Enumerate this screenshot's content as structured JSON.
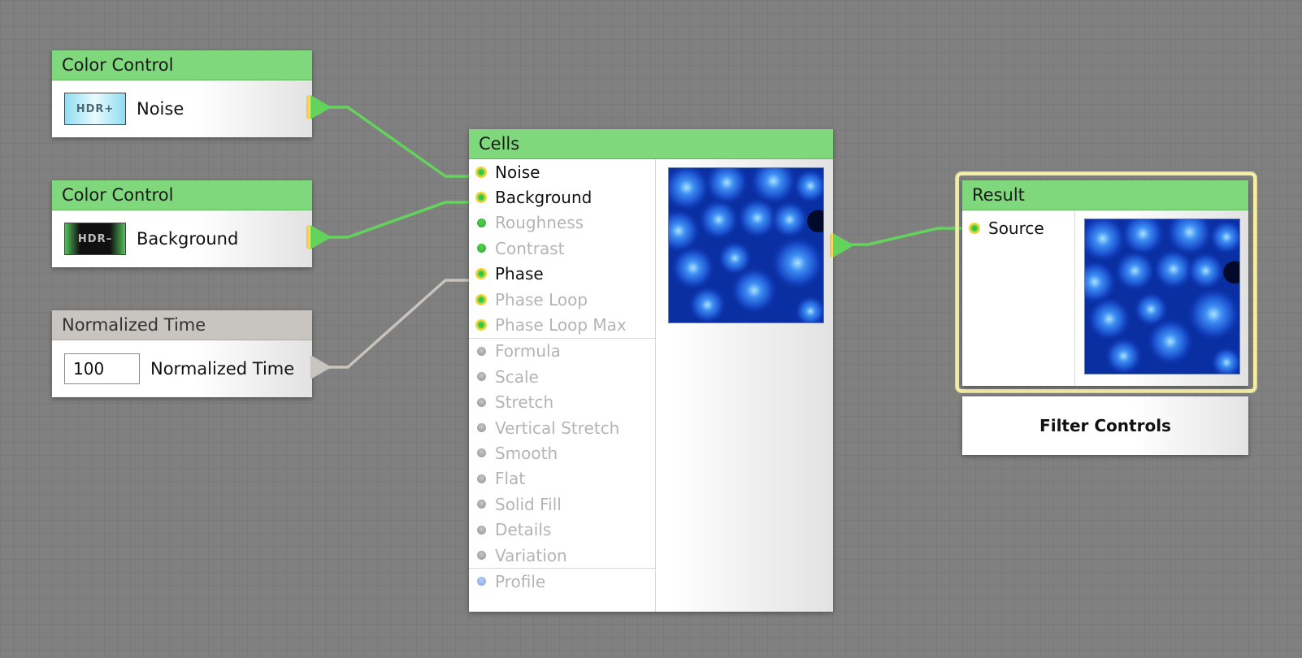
{
  "nodes": {
    "color_control_1": {
      "title": "Color Control",
      "badge": "HDR+",
      "label": "Noise"
    },
    "color_control_2": {
      "title": "Color Control",
      "badge": "HDR–",
      "label": "Background"
    },
    "normalized_time": {
      "title": "Normalized Time",
      "value": "100",
      "label": "Normalized Time"
    },
    "cells": {
      "title": "Cells",
      "params": [
        {
          "label": "Noise",
          "state": "connected"
        },
        {
          "label": "Background",
          "state": "connected"
        },
        {
          "label": "Roughness",
          "state": "unconnected-color"
        },
        {
          "label": "Contrast",
          "state": "unconnected-color"
        },
        {
          "label": "Phase",
          "state": "connected"
        },
        {
          "label": "Phase Loop",
          "state": "available"
        },
        {
          "label": "Phase Loop Max",
          "state": "available"
        },
        {
          "label": "Formula",
          "state": "unconnected"
        },
        {
          "label": "Scale",
          "state": "unconnected"
        },
        {
          "label": "Stretch",
          "state": "unconnected"
        },
        {
          "label": "Vertical Stretch",
          "state": "unconnected"
        },
        {
          "label": "Smooth",
          "state": "unconnected"
        },
        {
          "label": "Flat",
          "state": "unconnected"
        },
        {
          "label": "Solid Fill",
          "state": "unconnected"
        },
        {
          "label": "Details",
          "state": "unconnected"
        },
        {
          "label": "Variation",
          "state": "unconnected"
        },
        {
          "label": "Profile",
          "state": "unconnected-profile"
        }
      ]
    },
    "result": {
      "title": "Result",
      "input_label": "Source"
    }
  },
  "filter_controls_label": "Filter Controls",
  "colors": {
    "header_green": "#7fd87b",
    "header_gray": "#c8c4c0",
    "wire_green": "#63d35c",
    "wire_gray": "#c9c3bd",
    "selection_yellow": "#f3eea4",
    "canvas": "#808080"
  }
}
